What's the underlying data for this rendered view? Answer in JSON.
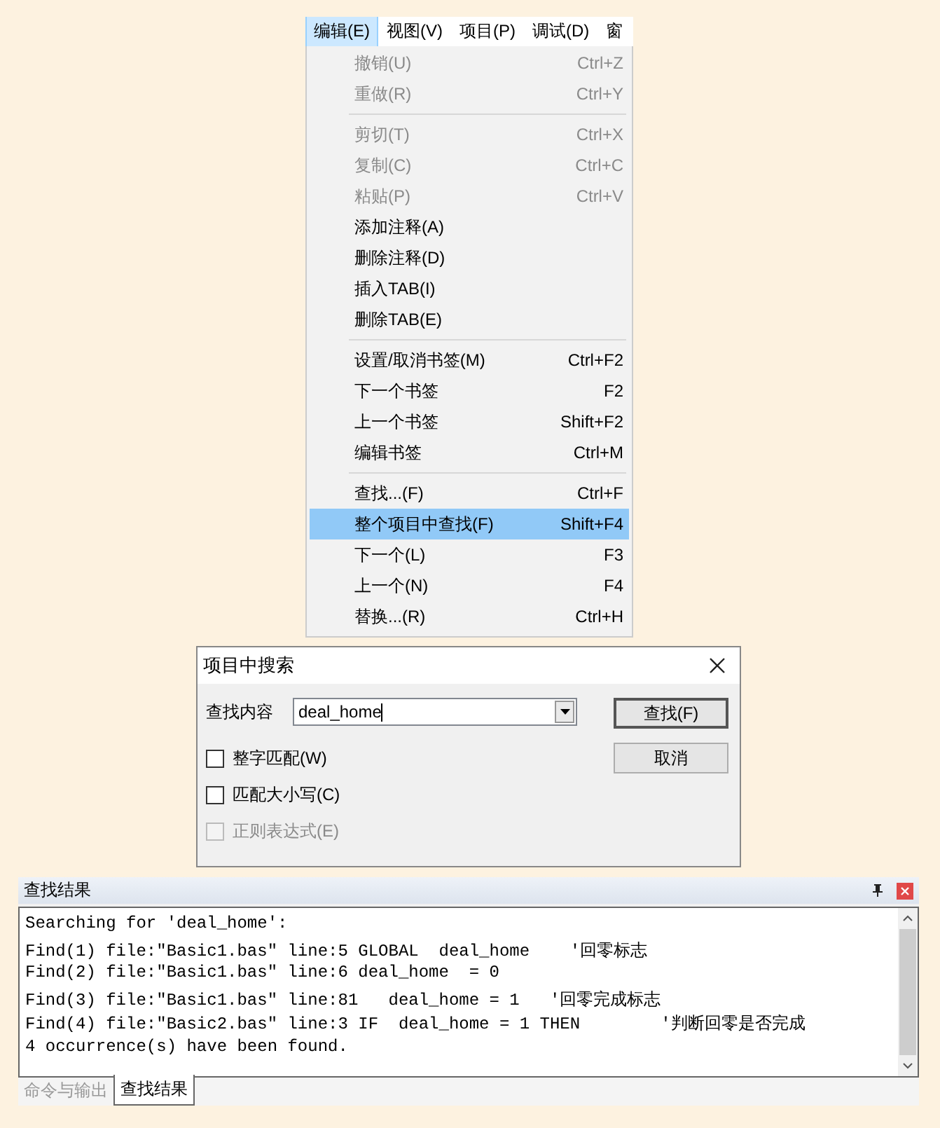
{
  "menu_bar": [
    {
      "label": "编辑(E)",
      "selected": true
    },
    {
      "label": "视图(V)",
      "selected": false
    },
    {
      "label": "项目(P)",
      "selected": false
    },
    {
      "label": "调试(D)",
      "selected": false
    },
    {
      "label": "窗",
      "selected": false
    }
  ],
  "edit_menu": [
    {
      "kind": "item",
      "label": "撤销(U)",
      "shortcut": "Ctrl+Z",
      "disabled": true,
      "selected": false
    },
    {
      "kind": "item",
      "label": "重做(R)",
      "shortcut": "Ctrl+Y",
      "disabled": true,
      "selected": false
    },
    {
      "kind": "separator"
    },
    {
      "kind": "item",
      "label": "剪切(T)",
      "shortcut": "Ctrl+X",
      "disabled": true,
      "selected": false
    },
    {
      "kind": "item",
      "label": "复制(C)",
      "shortcut": "Ctrl+C",
      "disabled": true,
      "selected": false
    },
    {
      "kind": "item",
      "label": "粘贴(P)",
      "shortcut": "Ctrl+V",
      "disabled": true,
      "selected": false
    },
    {
      "kind": "item",
      "label": "添加注释(A)",
      "disabled": false,
      "selected": false
    },
    {
      "kind": "item",
      "label": "删除注释(D)",
      "disabled": false,
      "selected": false
    },
    {
      "kind": "item",
      "label": "插入TAB(I)",
      "disabled": false,
      "selected": false
    },
    {
      "kind": "item",
      "label": "删除TAB(E)",
      "disabled": false,
      "selected": false
    },
    {
      "kind": "separator"
    },
    {
      "kind": "item",
      "label": "设置/取消书签(M)",
      "shortcut": "Ctrl+F2",
      "disabled": false,
      "selected": false
    },
    {
      "kind": "item",
      "label": "下一个书签",
      "shortcut": "F2",
      "disabled": false,
      "selected": false
    },
    {
      "kind": "item",
      "label": "上一个书签",
      "shortcut": "Shift+F2",
      "disabled": false,
      "selected": false
    },
    {
      "kind": "item",
      "label": "编辑书签",
      "shortcut": "Ctrl+M",
      "disabled": false,
      "selected": false
    },
    {
      "kind": "separator"
    },
    {
      "kind": "item",
      "label": "查找...(F)",
      "shortcut": "Ctrl+F",
      "disabled": false,
      "selected": false
    },
    {
      "kind": "item",
      "label": "整个项目中查找(F)",
      "shortcut": "Shift+F4",
      "disabled": false,
      "selected": true
    },
    {
      "kind": "item",
      "label": "下一个(L)",
      "shortcut": "F3",
      "disabled": false,
      "selected": false
    },
    {
      "kind": "item",
      "label": "上一个(N)",
      "shortcut": "F4",
      "disabled": false,
      "selected": false
    },
    {
      "kind": "item",
      "label": "替换...(R)",
      "shortcut": "Ctrl+H",
      "disabled": false,
      "selected": false
    }
  ],
  "dialog": {
    "title": "项目中搜索",
    "find_label": "查找内容",
    "find_value": "deal_home",
    "checkboxes": [
      {
        "label": "整字匹配(W)",
        "checked": false,
        "disabled": false
      },
      {
        "label": "匹配大小写(C)",
        "checked": false,
        "disabled": false
      },
      {
        "label": "正则表达式(E)",
        "checked": false,
        "disabled": true
      }
    ],
    "buttons": [
      "查找(F)",
      "取消"
    ]
  },
  "results_panel": {
    "title": "查找结果",
    "lines": [
      "Searching for 'deal_home':",
      "Find(1) file:\"Basic1.bas\" line:5 GLOBAL  deal_home    '回零标志",
      "Find(2) file:\"Basic1.bas\" line:6 deal_home  = 0",
      "Find(3) file:\"Basic1.bas\" line:81   deal_home = 1   '回零完成标志",
      "Find(4) file:\"Basic2.bas\" line:3 IF  deal_home = 1 THEN        '判断回零是否完成",
      "4 occurrence(s) have been found."
    ],
    "tabs": [
      {
        "label": "命令与输出",
        "selected": false
      },
      {
        "label": "查找结果",
        "selected": true
      }
    ]
  }
}
